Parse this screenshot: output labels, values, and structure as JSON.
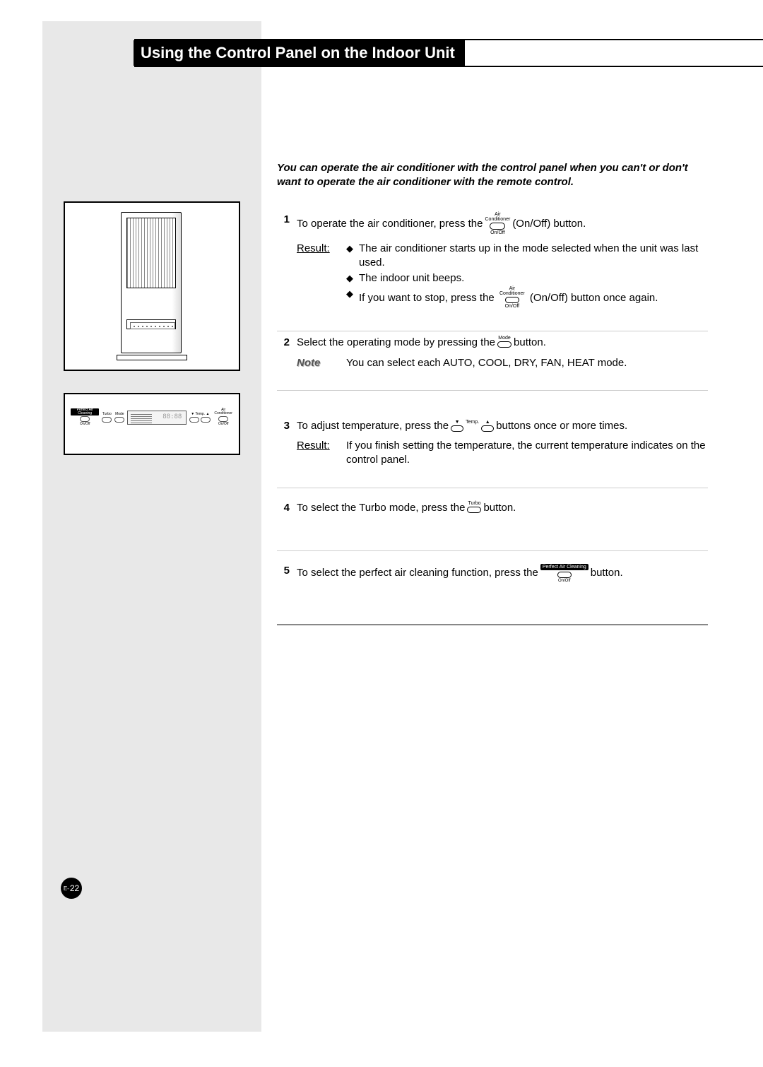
{
  "title": "Using the Control Panel on the Indoor Unit",
  "intro": "You can operate the air conditioner with the control panel when you can't or don't want to operate the air conditioner with the remote control.",
  "result_label": "Result",
  "note_label": "Note",
  "onoff_label": "(On/Off) button",
  "steps": {
    "s1": {
      "num": "1",
      "text_a": "To operate the air conditioner, press the ",
      "text_b": ".",
      "icon": {
        "top": "Air",
        "mid": "Conditioner",
        "bot": "On/Off"
      },
      "result_bullets": [
        "The air conditioner starts up in the mode selected when the unit was last used.",
        "The indoor unit beeps."
      ],
      "result_bullet3_a": "If you want to stop, press the ",
      "result_bullet3_b": "(On/Off) button once again."
    },
    "s2": {
      "num": "2",
      "text_a": "Select the operating mode by pressing the ",
      "text_b": " button.",
      "icon": {
        "top": "Mode"
      },
      "note_text": "You can select each AUTO, COOL, DRY, FAN, HEAT mode."
    },
    "s3": {
      "num": "3",
      "text_a": "To adjust temperature, press the ",
      "text_b": " buttons once or more times.",
      "icon": {
        "left_top": "▼",
        "center": "Temp.",
        "right_top": "▲"
      },
      "result_text": "If you finish setting the temperature, the current temperature indicates on the control panel."
    },
    "s4": {
      "num": "4",
      "text_a": "To select the Turbo mode, press the ",
      "text_b": " button.",
      "icon": {
        "top": "Turbo"
      }
    },
    "s5": {
      "num": "5",
      "text_a": "To select the perfect air cleaning function, press the ",
      "text_b": " button.",
      "icon": {
        "tag": "Perfect Air Cleaning",
        "bot": "On/Off"
      }
    }
  },
  "panel_labels": {
    "b1": "Perfect Air Cleaning",
    "b1s": "On/Off",
    "b2": "Turbo",
    "b3": "Mode",
    "r1": "Temp.",
    "r2": "Air Conditioner",
    "r2s": "On/Off"
  },
  "page_number": {
    "prefix": "E-",
    "num": "22"
  }
}
